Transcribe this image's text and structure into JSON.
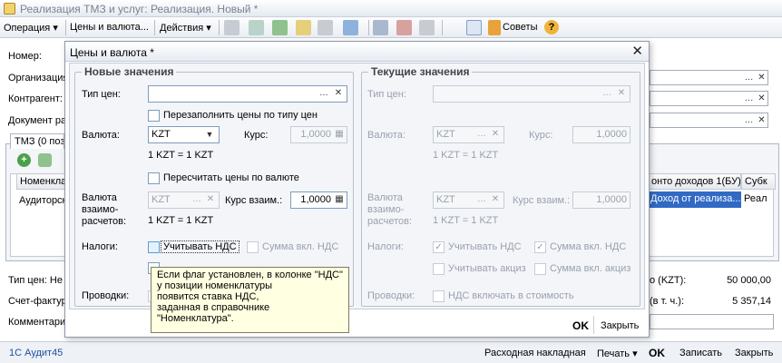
{
  "main": {
    "title": "Реализация ТМЗ и услуг: Реализация. Новый *",
    "toolbar": {
      "operation": "Операция ▾",
      "prices": "Цены и валюта...",
      "actions": "Действия ▾",
      "tips": "Советы"
    },
    "labels": {
      "number": "Номер:",
      "organization": "Организация:",
      "counterparty": "Контрагент:",
      "document": "Документ ра"
    },
    "tab_label": "ТМЗ (0 поз",
    "columns": [
      "Номенкла",
      "онто доходов 1(БУ)",
      "Субк"
    ],
    "row": [
      "Аудиторск",
      "Доход от реализа...",
      "Реал"
    ],
    "bottom": {
      "price_type": "Тип цен: Не",
      "invoice": "Счет-фактур",
      "comment": "Комментари",
      "total_label": "о (KZT):",
      "total_value": "50 000,00",
      "vat_label": "(в т. ч.):",
      "vat_value": "5 357,14"
    },
    "status": {
      "app": "1С Аудит45",
      "delivery_note": "Расходная накладная",
      "print": "Печать ▾",
      "ok": "OK",
      "save": "Записать",
      "close": "Закрыть"
    }
  },
  "dialog": {
    "title": "Цены и валюта *",
    "new_values": {
      "title": "Новые значения",
      "price_type_label": "Тип цен:",
      "price_type_value": "",
      "refill_prices": "Перезаполнить цены по типу цен",
      "currency_label": "Валюта:",
      "currency_value": "KZT",
      "rate_label": "Курс:",
      "rate_value": "1,0000",
      "currency_ratio": "1 KZT = 1 KZT",
      "recalc_prices": "Пересчитать цены по валюте",
      "settlement_currency_label": "Валюта\nвзаимо-\nрасчетов:",
      "settlement_currency_value": "KZT",
      "settlement_rate_label": "Курс взаим.:",
      "settlement_rate_value": "1,0000",
      "settlement_ratio": "1 KZT = 1 KZT",
      "taxes_label": "Налоги:",
      "account_vat": "Учитывать НДС",
      "amount_incl_vat": "Сумма вкл. НДС",
      "postings_label": "Проводки:"
    },
    "current_values": {
      "title": "Текущие значения",
      "price_type_label": "Тип цен:",
      "price_type_value": "",
      "currency_label": "Валюта:",
      "currency_value": "KZT",
      "rate_label": "Курс:",
      "rate_value": "1,0000",
      "currency_ratio": "1 KZT = 1 KZT",
      "settlement_currency_label": "Валюта\nвзаимо-\nрасчетов:",
      "settlement_currency_value": "KZT",
      "settlement_rate_label": "Курс взаим.:",
      "settlement_rate_value": "1,0000",
      "settlement_ratio": "1 KZT = 1 KZT",
      "taxes_label": "Налоги:",
      "account_vat": "Учитывать НДС",
      "amount_incl_vat": "Сумма вкл. НДС",
      "account_excise": "Учитывать акциз",
      "amount_incl_excise": "Сумма вкл. акциз",
      "postings_label": "Проводки:",
      "vat_in_cost": "НДС включать в стоимость"
    },
    "tooltip": "Если флаг установлен, в колонке \"НДС\"\nу позиции номенклатуры\nпоявится ставка НДС,\nзаданная в справочнике\n\"Номенклатура\".",
    "footer": {
      "ok": "OK",
      "close": "Закрыть"
    }
  }
}
